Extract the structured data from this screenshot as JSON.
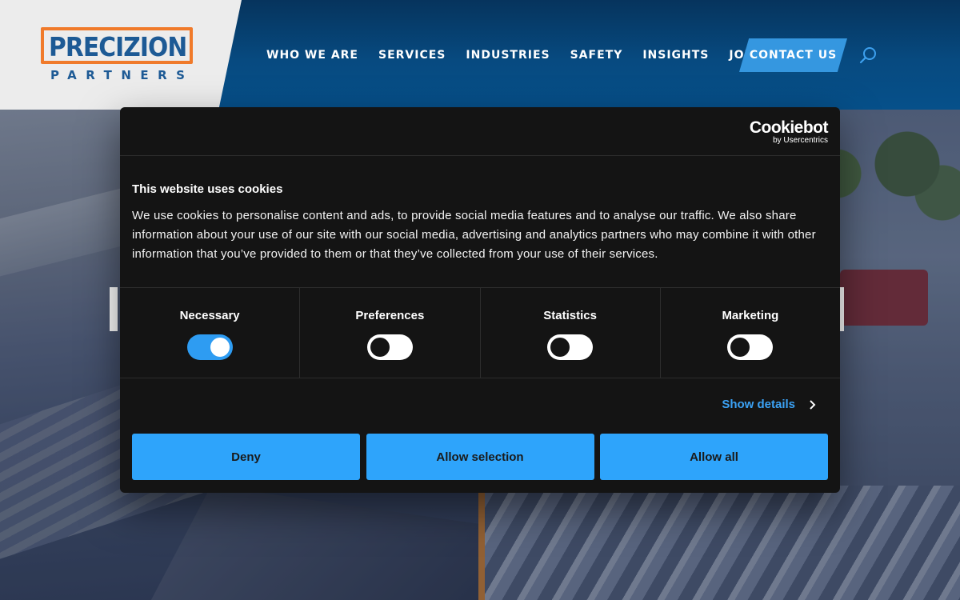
{
  "brand": {
    "wordmark": "PRECIZION",
    "subtitle": "PARTNERS"
  },
  "nav": {
    "items": [
      {
        "label": "WHO WE ARE"
      },
      {
        "label": "SERVICES"
      },
      {
        "label": "INDUSTRIES"
      },
      {
        "label": "SAFETY"
      },
      {
        "label": "INSIGHTS"
      },
      {
        "label": "JOIN OUR TEAM"
      }
    ],
    "contact_label": "CONTACT US",
    "search_icon": "search-icon"
  },
  "cookie_dialog": {
    "provider": "Cookiebot",
    "provider_sub": "by Usercentrics",
    "title": "This website uses cookies",
    "body": "We use cookies to personalise content and ads, to provide social media features and to analyse our traffic. We also share information about your use of our site with our social media, advertising and analytics partners who may combine it with other information that you’ve provided to them or that they’ve collected from your use of their services.",
    "toggles": [
      {
        "label": "Necessary",
        "enabled": true
      },
      {
        "label": "Preferences",
        "enabled": false
      },
      {
        "label": "Statistics",
        "enabled": false
      },
      {
        "label": "Marketing",
        "enabled": false
      }
    ],
    "show_details": "Show details",
    "buttons": {
      "deny": "Deny",
      "allow_selection": "Allow selection",
      "allow_all": "Allow all"
    }
  },
  "colors": {
    "brand_orange": "#f07a2a",
    "brand_blue": "#1d5a95",
    "header_blue": "#074a80",
    "cta_blue": "#3597e0",
    "cookie_button": "#2ea4fb"
  }
}
